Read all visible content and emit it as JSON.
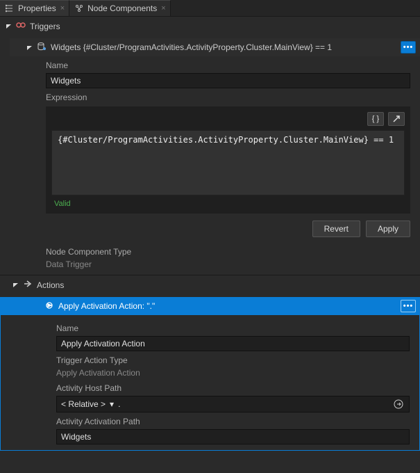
{
  "tabs": {
    "properties": "Properties",
    "components": "Node Components"
  },
  "triggers": {
    "heading": "Triggers",
    "item": {
      "titlePrefix": "Widgets",
      "titleExpr": "{#Cluster/ProgramActivities.ActivityProperty.Cluster.MainView} == 1",
      "nameLabel": "Name",
      "nameValue": "Widgets",
      "expressionLabel": "Expression",
      "expressionCode": "{#Cluster/ProgramActivities.ActivityProperty.Cluster.MainView} == 1",
      "validity": "Valid",
      "revert": "Revert",
      "apply": "Apply",
      "typeLabel": "Node Component Type",
      "typeValue": "Data Trigger"
    }
  },
  "actions": {
    "heading": "Actions",
    "item": {
      "title": "Apply Activation Action: \".\"",
      "nameLabel": "Name",
      "nameValue": "Apply Activation Action",
      "triggerActionTypeLabel": "Trigger Action Type",
      "triggerActionTypeValue": "Apply Activation Action",
      "hostPathLabel": "Activity Host Path",
      "hostPathMode": "< Relative >",
      "hostPathValue": ".",
      "activationPathLabel": "Activity Activation Path",
      "activationPathValue": "Widgets"
    }
  }
}
